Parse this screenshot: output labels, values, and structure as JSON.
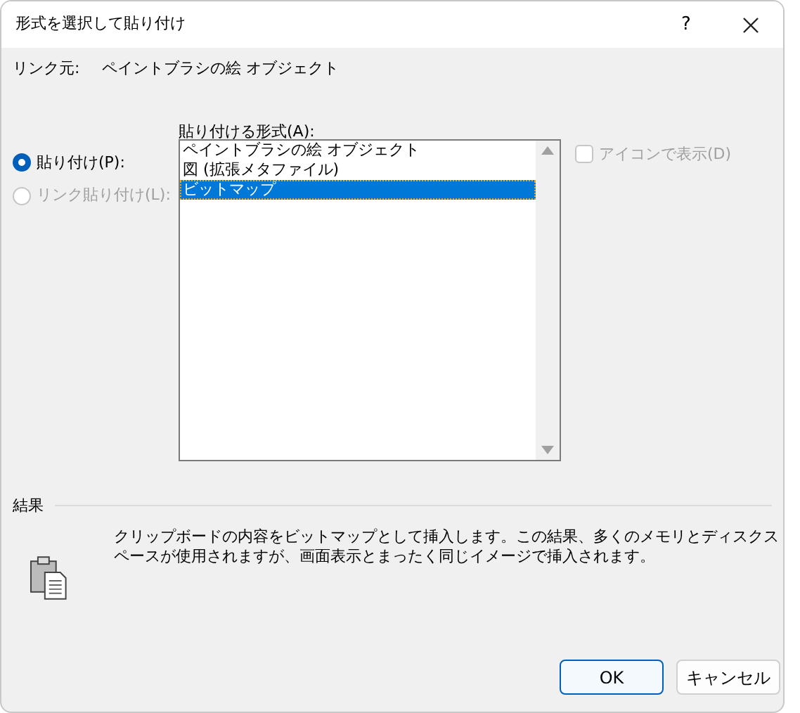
{
  "window": {
    "title": "形式を選択して貼り付け",
    "help": "?"
  },
  "source": {
    "label": "リンク元:",
    "value": "ペイントブラシの絵 オブジェクト"
  },
  "paste_options": [
    {
      "label": "貼り付け(P):",
      "selected": true,
      "disabled": false
    },
    {
      "label": "リンク貼り付け(L):",
      "selected": false,
      "disabled": true
    }
  ],
  "format_list": {
    "label": "貼り付ける形式(A):",
    "items": [
      {
        "label": "ペイントブラシの絵 オブジェクト",
        "selected": false
      },
      {
        "label": "図 (拡張メタファイル)",
        "selected": false
      },
      {
        "label": "ビットマップ",
        "selected": true
      }
    ]
  },
  "display_as_icon": {
    "label": "アイコンで表示(D)",
    "checked": false,
    "disabled": true
  },
  "result": {
    "label": "結果",
    "description": "クリップボードの内容をビットマップとして挿入します。この結果、多くのメモリとディスクスペースが使用されますが、画面表示とまったく同じイメージで挿入されます。"
  },
  "buttons": [
    {
      "label": "OK",
      "kind": "default"
    },
    {
      "label": "キャンセル",
      "kind": "normal"
    }
  ]
}
